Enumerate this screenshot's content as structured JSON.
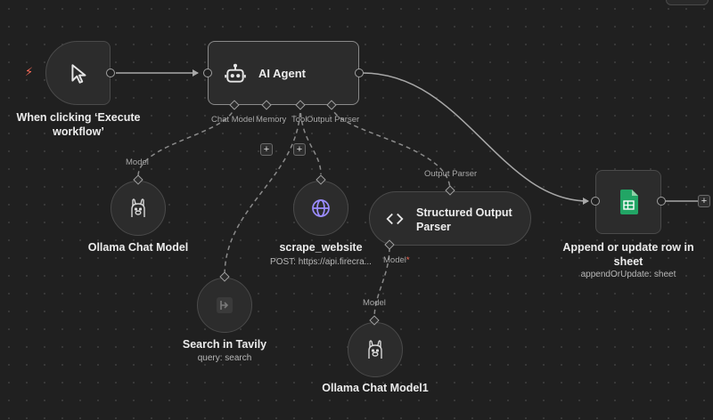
{
  "nodes": {
    "trigger": {
      "title": "When clicking ‘Execute workflow’",
      "icon": "cursor-icon"
    },
    "agent": {
      "title": "AI Agent",
      "icon": "robot-icon",
      "ports": {
        "chat_model": "Chat Model",
        "memory": "Memory",
        "tool": "Tool",
        "output_parser": "Output Parser"
      }
    },
    "ollama1": {
      "title": "Ollama Chat Model",
      "port_label": "Model",
      "icon": "llama-icon"
    },
    "tavily": {
      "title": "Search in Tavily",
      "subtitle": "query: search",
      "icon": "tavily-icon"
    },
    "scrape": {
      "title": "scrape_website",
      "subtitle": "POST: https://api.firecra...",
      "icon": "globe-icon"
    },
    "parser": {
      "title": "Structured Output Parser",
      "port_top": "Output Parser",
      "port_bottom": "Model",
      "required_mark": "*",
      "icon": "code-brackets-icon"
    },
    "ollama2": {
      "title": "Ollama Chat Model1",
      "port_label": "Model",
      "icon": "llama-icon"
    },
    "sheets": {
      "title": "Append or update row in sheet",
      "subtitle": "appendOrUpdate: sheet",
      "icon": "google-sheets-icon"
    }
  },
  "buttons": {
    "add": "+"
  },
  "colors": {
    "background": "#202020",
    "node_fill": "#2c2c2c",
    "accent": "#ff6d5a",
    "tool_icon": "#9b8cff",
    "sheets_green": "#22a565"
  }
}
